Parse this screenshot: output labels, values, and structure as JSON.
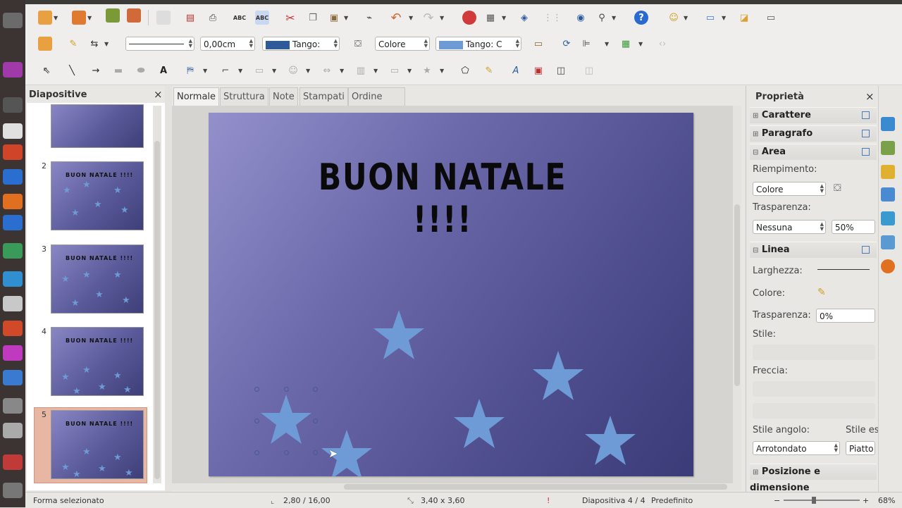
{
  "launcher": {
    "icons": [
      "dash-icon",
      "browser-icon",
      "files-icon",
      "writer-icon",
      "calc-icon",
      "impress-icon",
      "settings-icon",
      "terminal-icon",
      "store-icon",
      "trash-icon"
    ]
  },
  "toolbar1": {
    "icons": [
      "new-icon",
      "open-icon",
      "save-icon",
      "export-icon",
      "edit-icon",
      "pdf-icon",
      "print-icon",
      "spellcheck-icon",
      "autospell-icon",
      "cut-icon",
      "copy-icon",
      "paste-icon",
      "clone-icon",
      "undo-icon",
      "redo-icon",
      "chart-icon",
      "table-icon",
      "navigator-icon",
      "grid-icon",
      "zoom-icon",
      "help-icon",
      "gallery-icon",
      "slideshow-icon"
    ]
  },
  "toolbar2": {
    "line_width": "0,00cm",
    "line_color_label": "Tango:",
    "area_style": "Colore",
    "area_color_label": "Tango: C"
  },
  "slides_panel": {
    "title": "Diapositive",
    "close": "×",
    "thumb_title": "BUON NATALE !!!!",
    "numbers": [
      "2",
      "3",
      "4",
      "5"
    ]
  },
  "view_tabs": [
    "Normale",
    "Struttura",
    "Note",
    "Stampati",
    "Ordine diapositive"
  ],
  "slide": {
    "title": "BUON NATALE !!!!",
    "background": "#5a58a0",
    "star_color": "#6e9ad6"
  },
  "sidebar": {
    "title": "Proprietà",
    "close": "×",
    "sections": {
      "carattere": "Carattere",
      "paragrafo": "Paragrafo",
      "area": "Area",
      "linea": "Linea",
      "posizione": "Posizione e dimensione"
    },
    "riempimento_label": "Riempimento:",
    "riempimento_value": "Colore",
    "trasparenza_label": "Trasparenza:",
    "trasparenza_value": "Nessuna",
    "trasparenza_pct": "50%",
    "larghezza_label": "Larghezza:",
    "colore_label": "Colore:",
    "linea_trasparenza_label": "Trasparenza:",
    "linea_trasparenza_value": "0%",
    "stile_label": "Stile:",
    "freccia_label": "Freccia:",
    "stile_angolo_label": "Stile angolo:",
    "stile_angolo_value": "Arrotondato",
    "stile_estremita_label": "Stile es",
    "stile_estremita_value": "Piatto"
  },
  "status": {
    "selection": "Forma selezionato",
    "position": "2,80 / 16,00",
    "size": "3,40 x 3,60",
    "slide_counter": "Diapositiva 4 / 4",
    "master": "Predefinito",
    "zoom": "68%"
  }
}
